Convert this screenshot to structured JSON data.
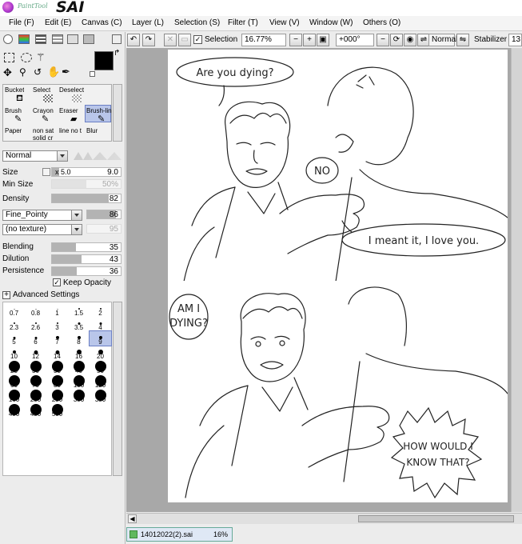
{
  "app": {
    "logo_small": "PaintTool",
    "logo_big": "SAI"
  },
  "menu": [
    "File (F)",
    "Edit (E)",
    "Canvas (C)",
    "Layer (L)",
    "Selection (S)",
    "Filter (T)",
    "View (V)",
    "Window (W)",
    "Others (O)"
  ],
  "toolbar": {
    "selection_label": "Selection",
    "zoom": "16.77%",
    "rotation": "+000°",
    "blend": "Normal",
    "stabilizer_label": "Stabilizer",
    "stabilizer_value": "13"
  },
  "tools": {
    "row1": [
      "Bucket",
      "Select",
      "Deselect"
    ],
    "row2": [
      "Brush",
      "Crayon",
      "Eraser",
      "Brush-lin"
    ],
    "row3": [
      "Paper",
      "non sat solid cr",
      "line no t",
      "Blur"
    ]
  },
  "brush": {
    "mode": "Normal",
    "size_label": "Size",
    "size_mult": "x 5.0",
    "size_value": "9.0",
    "minsize_label": "Min Size",
    "minsize_value": "50%",
    "density_label": "Density",
    "density_value": "82",
    "shape": "Fine_Pointy",
    "shape_value": "86",
    "texture": "(no texture)",
    "texture_value": "95",
    "blending_label": "Blending",
    "blending_value": "35",
    "dilution_label": "Dilution",
    "dilution_value": "43",
    "persistence_label": "Persistence",
    "persistence_value": "36",
    "keep_opacity": "Keep Opacity",
    "advanced": "Advanced Settings"
  },
  "sizes": [
    "0.7",
    "0.8",
    "1",
    "1.5",
    "2",
    "2.3",
    "2.6",
    "3",
    "3.5",
    "4",
    "5",
    "6",
    "7",
    "8",
    "9",
    "10",
    "12",
    "14",
    "16",
    "20",
    "25",
    "30",
    "35",
    "40",
    "50",
    "60",
    "70",
    "80",
    "100",
    "120",
    "160",
    "200",
    "250",
    "300",
    "350",
    "400",
    "450",
    "500"
  ],
  "selected_size": "9",
  "comic": {
    "panel1": {
      "bubble1": "Are you dying?",
      "bubble2": "NO",
      "bubble3": "I meant it, I love you."
    },
    "panel2": {
      "bubble1_l1": "AM I",
      "bubble1_l2": "DYING?",
      "bubble2_l1": "HOW WOULD I",
      "bubble2_l2": "KNOW THAT?"
    }
  },
  "status": {
    "filename": "14012022(2).sai",
    "zoom": "16%"
  },
  "colors": {
    "accent": "#b9c6ea",
    "primary": "#000000",
    "secondary": "#ffffff"
  }
}
